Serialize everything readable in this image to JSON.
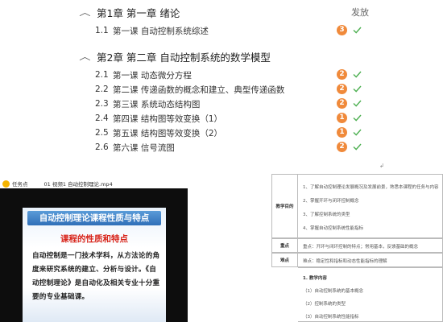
{
  "outline": {
    "publish_header": "发放",
    "chapters": [
      {
        "title": "第1章 第一章 绪论",
        "lessons": [
          {
            "num": "1.1",
            "title": "第一课 自动控制系统综述",
            "count": "3"
          }
        ]
      },
      {
        "title": "第2章 第二章 自动控制系统的数学模型",
        "lessons": [
          {
            "num": "2.1",
            "title": "第一课 动态微分方程",
            "count": "2"
          },
          {
            "num": "2.2",
            "title": "第二课 传递函数的概念和建立、典型传递函数",
            "count": "2"
          },
          {
            "num": "2.3",
            "title": "第三课 系统动态结构图",
            "count": "2"
          },
          {
            "num": "2.4",
            "title": "第四课 结构图等效变换（1）",
            "count": "1"
          },
          {
            "num": "2.5",
            "title": "第五课 结构图等效变换（2）",
            "count": "1"
          },
          {
            "num": "2.6",
            "title": "第六课 信号流图",
            "count": "2"
          }
        ]
      }
    ],
    "stray_mark": "↲"
  },
  "task": {
    "label": "任务点",
    "file": "01 视频1 自动控制理论.mp4",
    "slide_title": "自动控制理论课程性质与特点",
    "slide_subtitle": "课程的性质和特点",
    "slide_body": "自动控制是一门技术学科，从方法论的角度来研究系统的建立、分析与设计。《自动控制理论》是自动化及相关专业十分重要的专业基础课。"
  },
  "plan": {
    "row_labels": {
      "goal": "教学目的",
      "key": "重点",
      "difficult": "难点"
    },
    "goals": [
      "1、了解自动控制理论发展概况及发展前景，熟悉本课程的任务与内容",
      "2、掌握开环与闭环控制概念",
      "3、了解控制系统的类型",
      "4、掌握自动控制系统性能指标"
    ],
    "key_point": "重点：开环与闭环控制的特点；常用基本，反馈基础的概念",
    "difficult_point": "难点：稳定性和指标和动态性能指标的理解",
    "content_title": "1. 教学内容",
    "content_items": [
      "（1）自动控制系统的基本概念",
      "（2）控制系统的类型",
      "（3）自动控制系统性能指标"
    ]
  },
  "colors": {
    "badge": "#f08a3b",
    "check": "#4caf50",
    "banner": "#2f6fb8",
    "subtitle": "#d8261c"
  }
}
